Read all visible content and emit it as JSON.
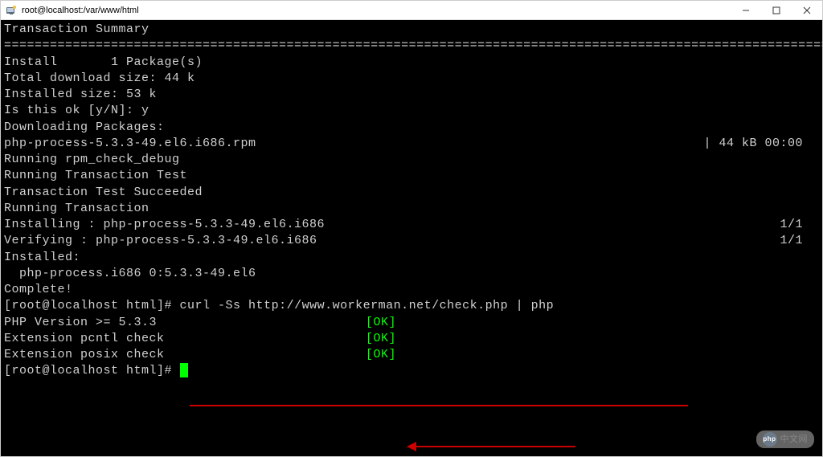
{
  "window": {
    "title": "root@localhost:/var/www/html"
  },
  "terminal": {
    "heading": "Transaction Summary",
    "separator": "================================================================================================================",
    "install_line": "Install       1 Package(s)",
    "download_size": "Total download size: 44 k",
    "installed_size": "Installed size: 53 k",
    "confirm": "Is this ok [y/N]: y",
    "downloading": "Downloading Packages:",
    "rpm_name": "php-process-5.3.3-49.el6.i686.rpm",
    "rpm_size": "|  44 kB     00:00",
    "rpm_check": "Running rpm_check_debug",
    "transaction_test": "Running Transaction Test",
    "test_succeeded": "Transaction Test Succeeded",
    "running_transaction": "Running Transaction",
    "installing_line": "  Installing : php-process-5.3.3-49.el6.i686",
    "installing_count": "1/1",
    "verifying_line": "  Verifying  : php-process-5.3.3-49.el6.i686",
    "verifying_count": "1/1",
    "installed": "Installed:",
    "installed_pkg": "  php-process.i686 0:5.3.3-49.el6",
    "complete": "Complete!",
    "prompt1": "[root@localhost html]# ",
    "command": "curl -Ss http://www.workerman.net/check.php | php",
    "check_php": "PHP Version >= 5.3.3",
    "check_pcntl": "Extension pcntl check",
    "check_posix": "Extension posix check",
    "ok": "[OK]",
    "prompt2": "[root@localhost html]# ",
    "empty": ""
  },
  "watermark": {
    "logo_text": "php",
    "text": "中文网"
  }
}
